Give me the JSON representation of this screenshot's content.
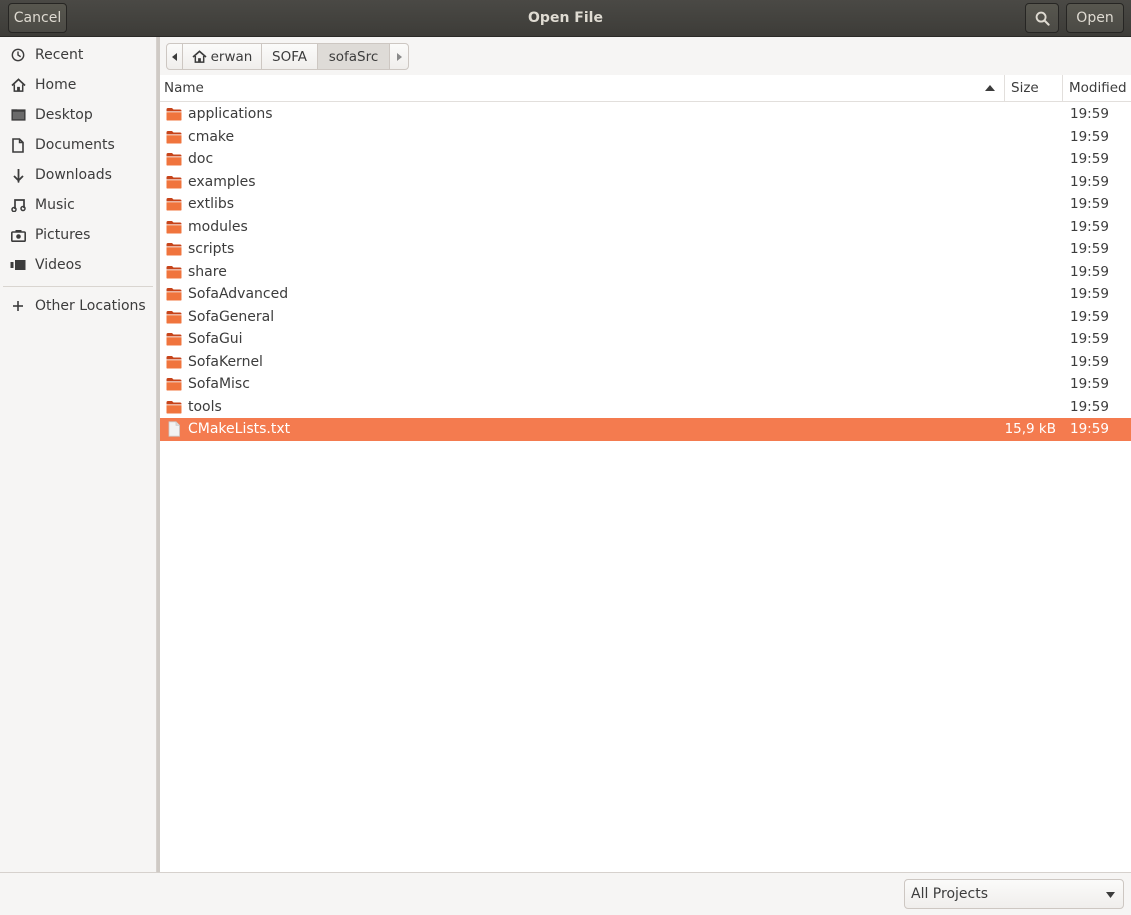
{
  "window": {
    "title": "Open File"
  },
  "header": {
    "cancel_label": "Cancel",
    "open_label": "Open",
    "search_icon": "search-icon"
  },
  "sidebar": {
    "items": [
      {
        "label": "Recent",
        "icon": "clock-icon"
      },
      {
        "label": "Home",
        "icon": "home-icon"
      },
      {
        "label": "Desktop",
        "icon": "desktop-icon"
      },
      {
        "label": "Documents",
        "icon": "document-icon"
      },
      {
        "label": "Downloads",
        "icon": "download-icon"
      },
      {
        "label": "Music",
        "icon": "music-icon"
      },
      {
        "label": "Pictures",
        "icon": "camera-icon"
      },
      {
        "label": "Videos",
        "icon": "video-icon"
      }
    ],
    "other_locations": {
      "label": "Other Locations",
      "icon": "plus-icon"
    }
  },
  "pathbar": {
    "segments": [
      "erwan",
      "SOFA",
      "sofaSrc"
    ],
    "active": "sofaSrc"
  },
  "columns": {
    "name": "Name",
    "size": "Size",
    "modified": "Modified"
  },
  "files": [
    {
      "name": "applications",
      "type": "folder",
      "size": "",
      "modified": "19:59"
    },
    {
      "name": "cmake",
      "type": "folder",
      "size": "",
      "modified": "19:59"
    },
    {
      "name": "doc",
      "type": "folder",
      "size": "",
      "modified": "19:59"
    },
    {
      "name": "examples",
      "type": "folder",
      "size": "",
      "modified": "19:59"
    },
    {
      "name": "extlibs",
      "type": "folder",
      "size": "",
      "modified": "19:59"
    },
    {
      "name": "modules",
      "type": "folder",
      "size": "",
      "modified": "19:59"
    },
    {
      "name": "scripts",
      "type": "folder",
      "size": "",
      "modified": "19:59"
    },
    {
      "name": "share",
      "type": "folder",
      "size": "",
      "modified": "19:59"
    },
    {
      "name": "SofaAdvanced",
      "type": "folder",
      "size": "",
      "modified": "19:59"
    },
    {
      "name": "SofaGeneral",
      "type": "folder",
      "size": "",
      "modified": "19:59"
    },
    {
      "name": "SofaGui",
      "type": "folder",
      "size": "",
      "modified": "19:59"
    },
    {
      "name": "SofaKernel",
      "type": "folder",
      "size": "",
      "modified": "19:59"
    },
    {
      "name": "SofaMisc",
      "type": "folder",
      "size": "",
      "modified": "19:59"
    },
    {
      "name": "tools",
      "type": "folder",
      "size": "",
      "modified": "19:59"
    },
    {
      "name": "CMakeLists.txt",
      "type": "file",
      "size": "15,9 kB",
      "modified": "19:59",
      "selected": true
    }
  ],
  "footer": {
    "filter_label": "All Projects"
  },
  "colors": {
    "accent": "#f47b4f",
    "folder": "#e95420",
    "headerbar": "#45443f"
  }
}
